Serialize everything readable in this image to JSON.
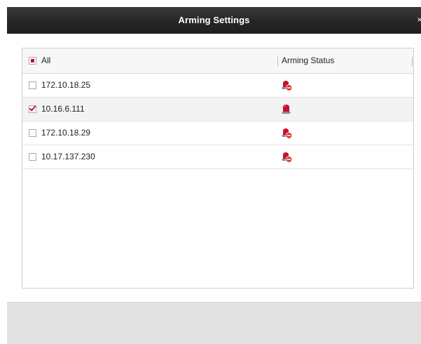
{
  "dialog": {
    "title": "Arming Settings",
    "close_glyph": "×"
  },
  "table": {
    "header": {
      "select_all_label": "All",
      "select_all_state": "partial",
      "status_column": "Arming Status"
    },
    "rows": [
      {
        "ip": "172.10.18.25",
        "checked": false,
        "status_icon": "siren-disarmed-icon"
      },
      {
        "ip": "10.16.6.111",
        "checked": true,
        "status_icon": "siren-armed-icon"
      },
      {
        "ip": "172.10.18.29",
        "checked": false,
        "status_icon": "siren-disarmed-icon"
      },
      {
        "ip": "10.17.137.230",
        "checked": false,
        "status_icon": "siren-disarmed-icon"
      }
    ]
  },
  "colors": {
    "accent_red": "#c8102e",
    "titlebar": "#262626"
  }
}
